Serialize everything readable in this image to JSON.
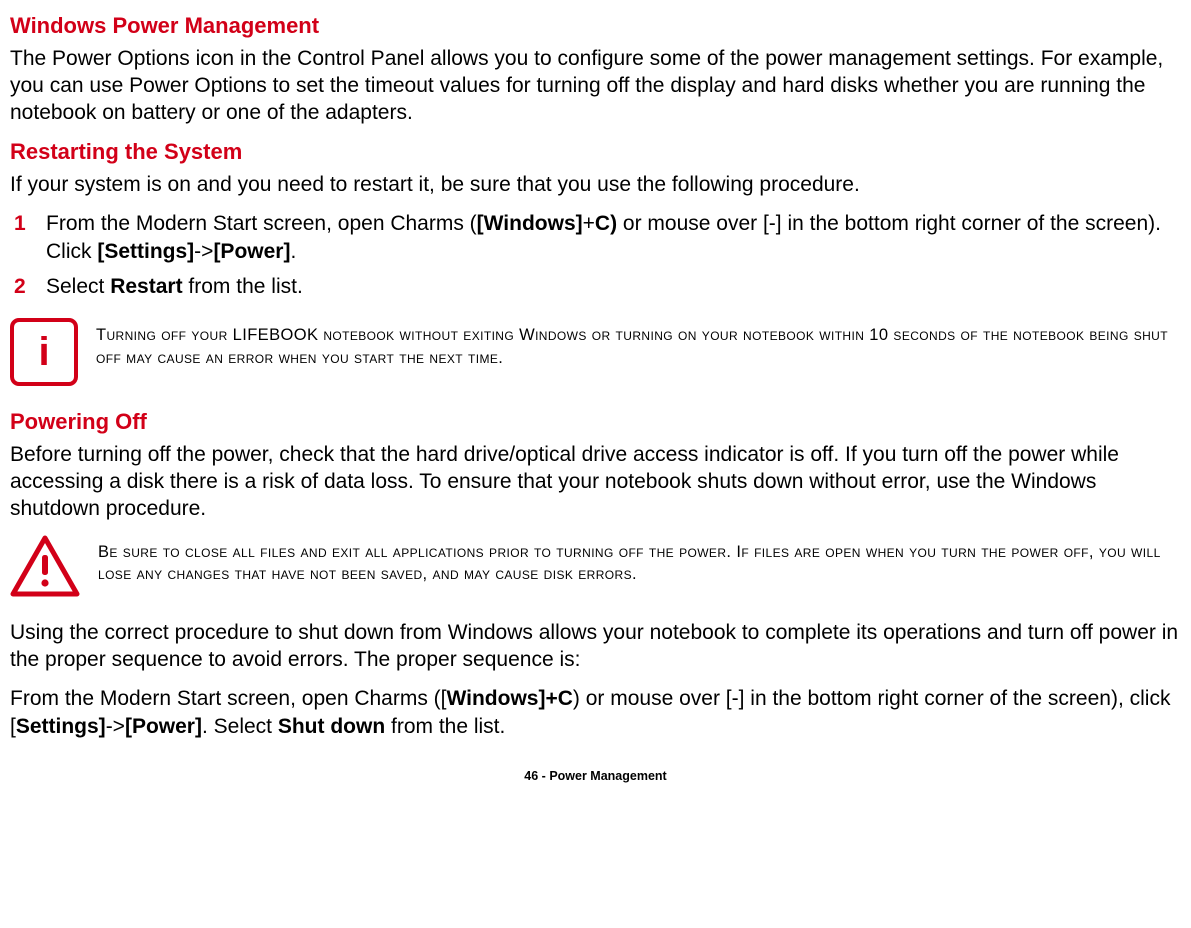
{
  "sections": {
    "wpm": {
      "title": "Windows Power Management",
      "body": "The Power Options icon in the Control Panel allows you to configure some of the power management settings. For example, you can use Power Options to set the timeout values for turning off the display and hard disks whether you are running the notebook on battery or one of the adapters."
    },
    "restart": {
      "title": "Restarting the System",
      "lead": "If your system is on and you need to restart it, be sure that you use the following procedure.",
      "steps": [
        {
          "n": "1",
          "pre": "From the Modern Start screen, open Charms (",
          "b1": "[Windows]",
          "plus": "+",
          "b2": "C)",
          "mid": " or mouse over [-] in the bottom right corner of the screen). Click ",
          "b3": "[Settings]",
          "arrow": "->",
          "b4": "[Power]",
          "post": "."
        },
        {
          "n": "2",
          "pre": "Select ",
          "b1": "Restart",
          "post": " from the list."
        }
      ]
    },
    "info_note": "Turning off your LIFEBOOK notebook without exiting Windows or turning on your notebook within 10 seconds of the notebook being shut off may cause an error when you start the next time.",
    "poweroff": {
      "title": "Powering Off",
      "p1": "Before turning off the power, check that the hard drive/optical drive access indicator is off. If you turn off the power while accessing a disk there is a risk of data loss. To ensure that your notebook shuts down without error, use the Windows shutdown procedure."
    },
    "warn_note": "Be sure to close all files and exit all applications prior to turning off the power. If files are open when you turn the power off, you will lose any changes that have not been saved, and may cause disk errors.",
    "final": {
      "p": "Using the correct procedure to shut down from Windows allows your notebook to complete its operations and turn off power in the proper sequence to avoid errors. The proper sequence is:",
      "proc": {
        "pre": "From the Modern Start screen, open Charms ([",
        "b1": "Windows]+C",
        "mid1": ") or mouse over [-] in the bottom right corner of the screen), click [",
        "b2": "Settings]",
        "arrow": "->",
        "b3": "[Power]",
        "mid2": ". Select ",
        "b4": "Shut down",
        "post": " from the list."
      }
    }
  },
  "footer": {
    "page_num": "46",
    "sep": " - ",
    "section": "Power Management"
  },
  "icons": {
    "info_glyph": "i"
  },
  "colors": {
    "accent": "#d20018"
  }
}
